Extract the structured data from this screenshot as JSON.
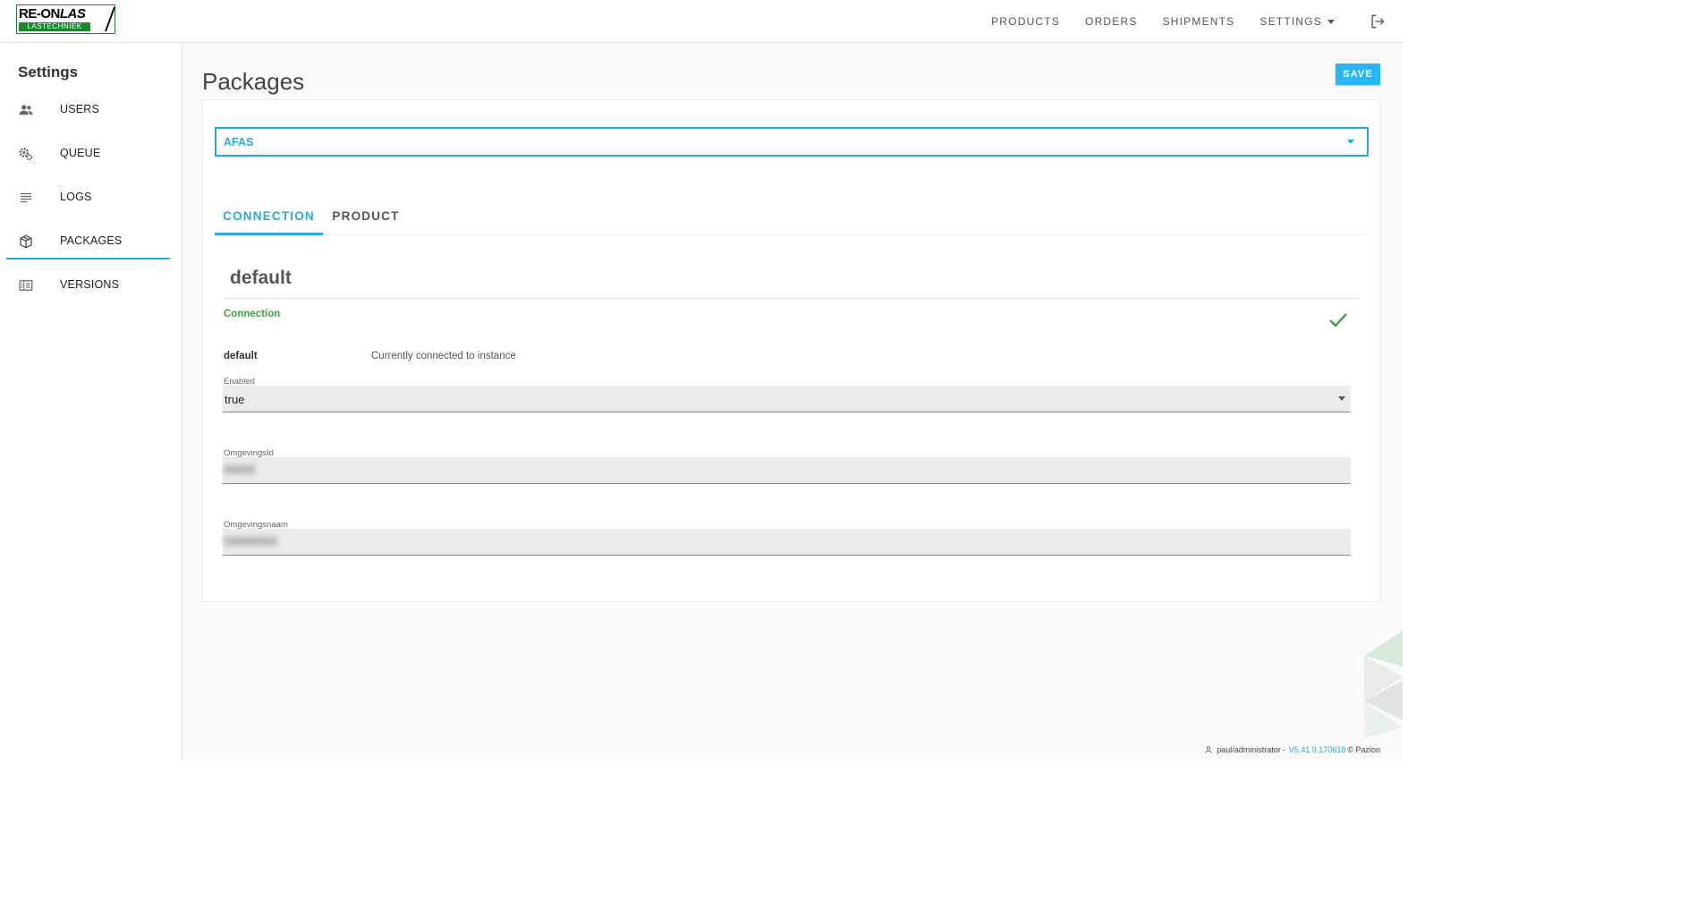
{
  "brand": {
    "logo_main": "RE-ON",
    "logo_script": "LAS",
    "logo_sub": "LASTECHNIEK"
  },
  "topnav": {
    "items": [
      "PRODUCTS",
      "ORDERS",
      "SHIPMENTS",
      "SETTINGS"
    ],
    "logout_icon": "logout-icon"
  },
  "sidebar": {
    "title": "Settings",
    "items": [
      {
        "label": "USERS",
        "icon": "users-icon"
      },
      {
        "label": "QUEUE",
        "icon": "gears-icon"
      },
      {
        "label": "LOGS",
        "icon": "list-icon"
      },
      {
        "label": "PACKAGES",
        "icon": "package-icon",
        "active": true
      },
      {
        "label": "VERSIONS",
        "icon": "versions-icon"
      }
    ]
  },
  "main": {
    "title": "Packages",
    "save_label": "SAVE",
    "package_select": "AFAS",
    "tabs": [
      {
        "label": "CONNECTION",
        "active": true
      },
      {
        "label": "PRODUCT",
        "active": false
      }
    ],
    "section_title": "default",
    "connection_label": "Connection",
    "instance_name": "default",
    "instance_status": "Currently connected to instance",
    "fields": {
      "enabled": {
        "label": "Enabled",
        "value": "true"
      },
      "omgevingsid": {
        "label": "OmgevingsId",
        "value": "00000"
      },
      "omgevingsnaam": {
        "label": "Omgevingsnaam",
        "value": "O00000AA"
      }
    }
  },
  "footer": {
    "user": "paul/administrator",
    "sep": "-",
    "version": "V5.41.9.170618",
    "copyright": "© Pazion"
  },
  "colors": {
    "accent": "#29a8e0",
    "success": "#43a047",
    "brand_green": "#1a8a2e"
  }
}
